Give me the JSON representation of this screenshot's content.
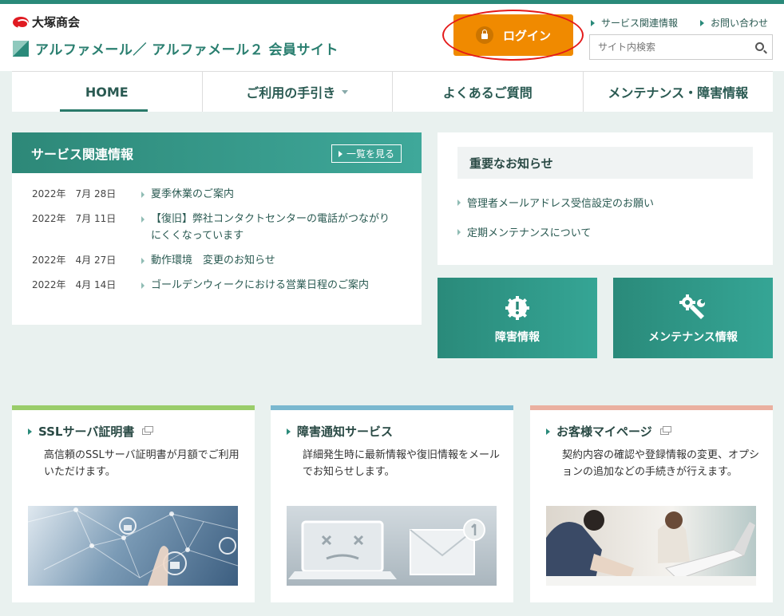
{
  "header": {
    "corp_name": "大塚商会",
    "site_title": "アルファメール／ アルファメール２ 会員サイト",
    "login_label": "ログイン",
    "links": [
      "サービス関連情報",
      "お問い合わせ"
    ],
    "search_placeholder": "サイト内検索"
  },
  "nav": {
    "items": [
      {
        "label": "HOME"
      },
      {
        "label": "ご利用の手引き"
      },
      {
        "label": "よくあるご質問"
      },
      {
        "label": "メンテナンス・障害情報"
      }
    ]
  },
  "service_info": {
    "title": "サービス関連情報",
    "more_label": "一覧を見る",
    "items": [
      {
        "date": "2022年　7月 28日",
        "title": "夏季休業のご案内"
      },
      {
        "date": "2022年　7月 11日",
        "title": "【復旧】弊社コンタクトセンターの電話がつながりにくくなっています"
      },
      {
        "date": "2022年　4月 27日",
        "title": "動作環境　変更のお知らせ"
      },
      {
        "date": "2022年　4月 14日",
        "title": "ゴールデンウィークにおける営業日程のご案内"
      }
    ]
  },
  "important": {
    "title": "重要なお知らせ",
    "items": [
      "管理者メールアドレス受信設定のお願い",
      "定期メンテナンスについて"
    ]
  },
  "tiles": [
    {
      "label": "障害情報",
      "icon": "alert-gear-icon"
    },
    {
      "label": "メンテナンス情報",
      "icon": "wrench-gear-icon"
    }
  ],
  "cards": [
    {
      "title": "SSLサーバ証明書",
      "desc": "高信頼のSSLサーバ証明書が月額でご利用いただけます。",
      "color": "#9acd6a",
      "external": true
    },
    {
      "title": "障害通知サービス",
      "desc": "詳細発生時に最新情報や復旧情報をメールでお知らせします。",
      "color": "#7ab8cf",
      "external": false
    },
    {
      "title": "お客様マイページ",
      "desc": "契約内容の確認や登録情報の変更、オプションの追加などの手続きが行えます。",
      "color": "#eab0a0",
      "external": true
    }
  ],
  "colors": {
    "accent": "#2a8a7a",
    "login": "#f08a00",
    "highlight": "#e41a1a"
  }
}
